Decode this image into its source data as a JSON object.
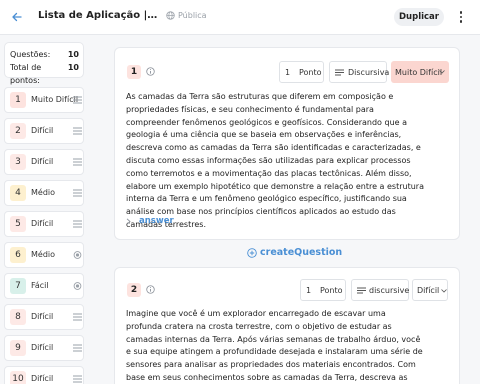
{
  "header": {
    "title": "Lista de Aplicação | Camadas da Terra",
    "visibility": "Pública",
    "duplicate_label": "Duplicar"
  },
  "stats": {
    "questions_label": "Questões:",
    "questions_value": "10",
    "points_label": "Total de pontos:",
    "points_value": "10"
  },
  "sidebar": {
    "items": [
      {
        "num": "1",
        "difficulty": "Muito Difícil",
        "color": "#fde3df",
        "icon": "lines-icon"
      },
      {
        "num": "2",
        "difficulty": "Difícil",
        "color": "#fde9e6",
        "icon": "lines-icon"
      },
      {
        "num": "3",
        "difficulty": "Difícil",
        "color": "#fde9e6",
        "icon": "lines-icon"
      },
      {
        "num": "4",
        "difficulty": "Médio",
        "color": "#fdf0cf",
        "icon": "lines-icon"
      },
      {
        "num": "5",
        "difficulty": "Difícil",
        "color": "#fde9e6",
        "icon": "lines-icon"
      },
      {
        "num": "6",
        "difficulty": "Médio",
        "color": "#fdf0cf",
        "icon": "radio-icon"
      },
      {
        "num": "7",
        "difficulty": "Fácil",
        "color": "#d8f0ea",
        "icon": "radio-icon"
      },
      {
        "num": "8",
        "difficulty": "Difícil",
        "color": "#fde9e6",
        "icon": "lines-icon"
      },
      {
        "num": "9",
        "difficulty": "Difícil",
        "color": "#fde9e6",
        "icon": "lines-icon"
      },
      {
        "num": "10",
        "difficulty": "Difícil",
        "color": "#fde9e6",
        "icon": "lines-icon"
      }
    ]
  },
  "questions": [
    {
      "num": "1",
      "points_value": "1",
      "points_label": "Ponto",
      "type_label": "Discursiva",
      "difficulty": "Muito Difícil",
      "difficulty_color": "#fbd6d0",
      "text": "As camadas da Terra são estruturas que diferem em composição e propriedades físicas, e seu conhecimento é fundamental para compreender fenômenos geológicos e geofísicos. Considerando que a geologia é uma ciência que se baseia em observações e inferências, descreva como as camadas da Terra são identificadas e caracterizadas, e discuta como essas informações são utilizadas para explicar processos como terremotos e a movimentação das placas tectônicas. Além disso, elabore um exemplo hipotético que demonstre a relação entre a estrutura interna da Terra e um fenômeno geológico específico, justificando sua análise com base nos princípios científicos aplicados ao estudo das camadas terrestres.",
      "answer_label": "answer"
    },
    {
      "num": "2",
      "points_value": "1",
      "points_label": "Ponto",
      "type_label": "discursive",
      "difficulty": "Difícil",
      "difficulty_color": "#fde9e6",
      "text": "Imagine que você é um explorador encarregado de escavar uma profunda cratera na crosta terrestre, com o objetivo de estudar as camadas internas da Terra. Após várias semanas de trabalho árduo, você e sua equipe atingem a profundidade desejada e instalaram uma série de sensores para analisar as propriedades dos materiais encontrados. Com base em seus conhecimentos sobre as camadas da Terra, descreva as características distintas que você esperaria encontrar nos"
    }
  ],
  "create_label": "createQuestion",
  "colors": {
    "accent": "#4a8fd4"
  }
}
